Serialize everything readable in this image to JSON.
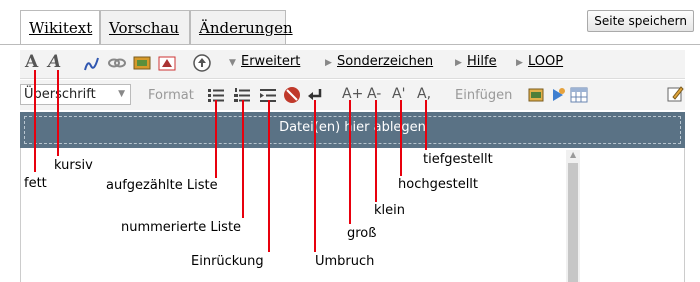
{
  "tabs": [
    {
      "label": "Wikitext"
    },
    {
      "label": "Vorschau"
    },
    {
      "label": "Änderungen"
    }
  ],
  "save_button": "Seite speichern",
  "toolbar1": {
    "bold": "A",
    "italic": "A",
    "menus": [
      "Erweitert",
      "Sonderzeichen",
      "Hilfe",
      "LOOP"
    ]
  },
  "toolbar2": {
    "heading_select": "Überschrift",
    "format_label": "Format",
    "insert_label": "Einfügen",
    "big": "A+",
    "small": "A-",
    "sup": "A'",
    "sub": "A,"
  },
  "dropzone": "Datei(en) hier ablegen",
  "annotations": {
    "fett": "fett",
    "kursiv": "kursiv",
    "bullet": "aufgezählte Liste",
    "numbered": "nummerierte Liste",
    "indent": "Einrückung",
    "linebreak": "Umbruch",
    "big": "groß",
    "small": "klein",
    "sup": "hochgestellt",
    "sub": "tiefgestellt"
  },
  "colors": {
    "annotation": "#e8000d",
    "dropzone": "#5a7285"
  }
}
